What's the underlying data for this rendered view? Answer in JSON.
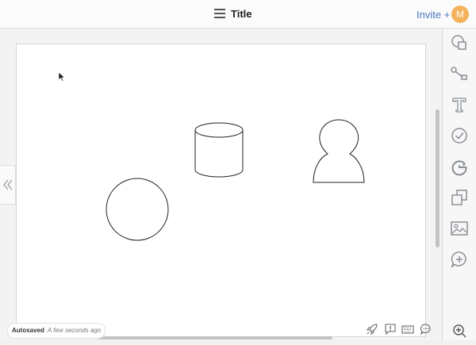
{
  "header": {
    "title": "Title",
    "invite_label": "Invite +",
    "avatar_initial": "M",
    "avatar_color": "#f5b35e",
    "accent_color": "#4a78c2"
  },
  "canvas": {
    "shapes": [
      {
        "kind": "circle",
        "name": "circle-shape"
      },
      {
        "kind": "cylinder",
        "name": "cylinder-shape"
      },
      {
        "kind": "person",
        "name": "person-shape"
      }
    ]
  },
  "right_toolbar": {
    "tools": [
      "shapes-icon",
      "connector-icon",
      "text-icon",
      "check-icon",
      "google-icon",
      "layers-icon",
      "image-icon",
      "add-comment-icon",
      "zoom-in-icon"
    ]
  },
  "status": {
    "autosaved_label": "Autosaved",
    "autosaved_time": "A few seconds ago"
  },
  "bottom_toolbar": {
    "tools": [
      "rocket-icon",
      "feedback-icon",
      "keyboard-icon",
      "chat-icon"
    ]
  }
}
